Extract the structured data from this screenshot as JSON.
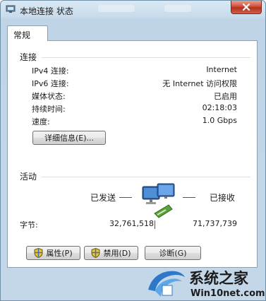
{
  "window": {
    "title": "本地连接 状态"
  },
  "tabs": [
    {
      "label": "常规"
    }
  ],
  "connection": {
    "heading": "连接",
    "rows": [
      {
        "label": "IPv4 连接:",
        "value": "Internet"
      },
      {
        "label": "IPv6 连接:",
        "value": "无 Internet 访问权限"
      },
      {
        "label": "媒体状态:",
        "value": "已启用"
      },
      {
        "label": "持续时间:",
        "value": "02:18:03"
      },
      {
        "label": "速度:",
        "value": "1.0 Gbps"
      }
    ],
    "details_button": "详细信息(E)..."
  },
  "activity": {
    "heading": "活动",
    "sent_label": "已发送",
    "received_label": "已接收",
    "bytes_label": "字节:",
    "bytes_sent": "32,761,518",
    "bytes_received": "71,737,739"
  },
  "buttons": {
    "properties": "属性(P)",
    "disable": "禁用(D)",
    "diagnose": "诊断(G)"
  },
  "watermark": {
    "brand": "系统之家",
    "url": "Win10net.com"
  }
}
